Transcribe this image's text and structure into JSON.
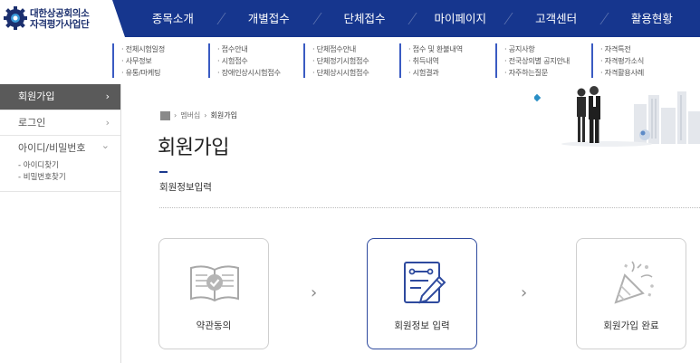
{
  "logo": {
    "line1": "대한상공회의소",
    "line2": "자격평가사업단"
  },
  "nav": [
    {
      "label": "종목소개"
    },
    {
      "label": "개별접수"
    },
    {
      "label": "단체접수"
    },
    {
      "label": "마이페이지"
    },
    {
      "label": "고객센터"
    },
    {
      "label": "활용현황"
    }
  ],
  "mega": [
    [
      "· 전체시험일정",
      "· 사무정보",
      "· 유통/마케팅"
    ],
    [
      "· 접수안내",
      "· 시험접수",
      "· 장애인상시시험접수"
    ],
    [
      "· 단체접수안내",
      "· 단체정기시험접수",
      "· 단체상시시험접수"
    ],
    [
      "· 접수 및 환불내역",
      "· 취득내역",
      "· 시험결과"
    ],
    [
      "· 공지사항",
      "· 전국상의별 공지안내",
      "· 자주하는질문"
    ],
    [
      "· 자격특전",
      "· 자격평가소식",
      "· 자격활용사례"
    ]
  ],
  "sidebar": {
    "items": [
      {
        "label": "회원가입",
        "arrow": "›"
      },
      {
        "label": "로그인",
        "arrow": "›"
      },
      {
        "label": "아이디/비밀번호",
        "arrow": "⌄"
      }
    ],
    "subitems": [
      "- 아이디찾기",
      "- 비밀번호찾기"
    ]
  },
  "breadcrumb": {
    "sep1": "›",
    "level1": "멤버십",
    "sep2": "›",
    "level2": "회원가입"
  },
  "page": {
    "title": "회원가입",
    "section": "회원정보입력"
  },
  "steps": [
    {
      "label": "약관동의"
    },
    {
      "label": "회원정보 입력"
    },
    {
      "label": "회원가입 완료"
    }
  ],
  "step_arrow": "›",
  "colors": {
    "brand": "#16368e",
    "accent": "#1b3a8e",
    "sidebar_active": "#5a5a5a"
  }
}
